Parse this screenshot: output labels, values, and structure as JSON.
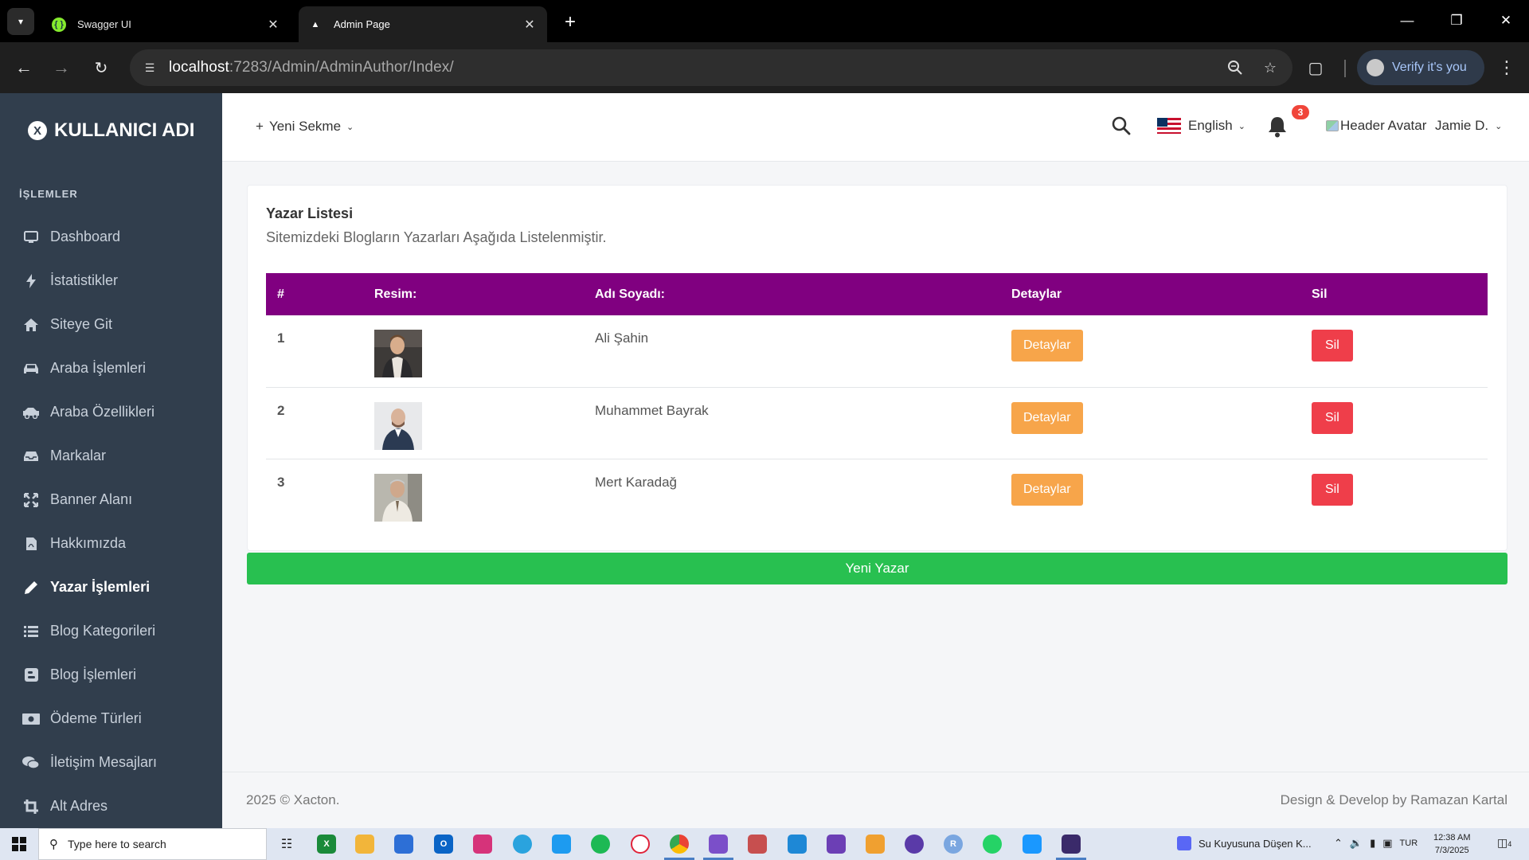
{
  "browser": {
    "tabs": [
      {
        "title": "Swagger UI",
        "active": false,
        "icon": "swagger-icon"
      },
      {
        "title": "Admin Page",
        "active": true,
        "icon": "admin-triangle-icon"
      }
    ],
    "url_host": "localhost",
    "url_rest": ":7283/Admin/AdminAuthor/Index/",
    "profile_label": "Verify it's you"
  },
  "sidebar": {
    "brand": "KULLANICI ADI",
    "section_title": "İŞLEMLER",
    "items": [
      {
        "label": "Dashboard",
        "icon": "monitor-icon",
        "active": false
      },
      {
        "label": "İstatistikler",
        "icon": "bolt-icon",
        "active": false
      },
      {
        "label": "Siteye Git",
        "icon": "home-icon",
        "active": false
      },
      {
        "label": "Araba İşlemleri",
        "icon": "car-icon",
        "active": false
      },
      {
        "label": "Araba Özellikleri",
        "icon": "car-side-icon",
        "active": false
      },
      {
        "label": "Markalar",
        "icon": "tray-icon",
        "active": false
      },
      {
        "label": "Banner Alanı",
        "icon": "expand-icon",
        "active": false
      },
      {
        "label": "Hakkımızda",
        "icon": "file-pdf-icon",
        "active": false
      },
      {
        "label": "Yazar İşlemleri",
        "icon": "pencil-icon",
        "active": true
      },
      {
        "label": "Blog Kategorileri",
        "icon": "list-icon",
        "active": false
      },
      {
        "label": "Blog İşlemleri",
        "icon": "blogger-icon",
        "active": false
      },
      {
        "label": "Ödeme Türleri",
        "icon": "money-icon",
        "active": false
      },
      {
        "label": "İletişim Mesajları",
        "icon": "comments-icon",
        "active": false
      },
      {
        "label": "Alt Adres",
        "icon": "crop-icon",
        "active": false
      }
    ]
  },
  "header": {
    "new_tab": "Yeni Sekme",
    "language": "English",
    "notification_count": "3",
    "avatar_alt": "Header Avatar",
    "user_name": "Jamie D."
  },
  "main": {
    "title": "Yazar Listesi",
    "subtitle": "Sitemizdeki Blogların Yazarları Aşağıda Listelenmiştir.",
    "columns": [
      "#",
      "Resim:",
      "Adı Soyadı:",
      "Detaylar",
      "Sil"
    ],
    "rows": [
      {
        "num": "1",
        "name": "Ali Şahin",
        "details_label": "Detaylar",
        "delete_label": "Sil"
      },
      {
        "num": "2",
        "name": "Muhammet Bayrak",
        "details_label": "Detaylar",
        "delete_label": "Sil"
      },
      {
        "num": "3",
        "name": "Mert Karadağ",
        "details_label": "Detaylar",
        "delete_label": "Sil"
      }
    ],
    "new_author_label": "Yeni Yazar"
  },
  "footer": {
    "left": "2025 © Xacton.",
    "right": "Design & Develop by Ramazan Kartal"
  },
  "taskbar": {
    "search_placeholder": "Type here to search",
    "media_title": "Su Kuyusuna Düşen K...",
    "language": "TUR",
    "time": "12:38 AM",
    "date": "7/3/2025",
    "notification_count": "4"
  },
  "colors": {
    "table_header": "#800080",
    "sidebar_bg": "#313e4d",
    "details_button": "#f7a54a",
    "delete_button": "#ef3e4a",
    "new_button": "#28c050"
  }
}
